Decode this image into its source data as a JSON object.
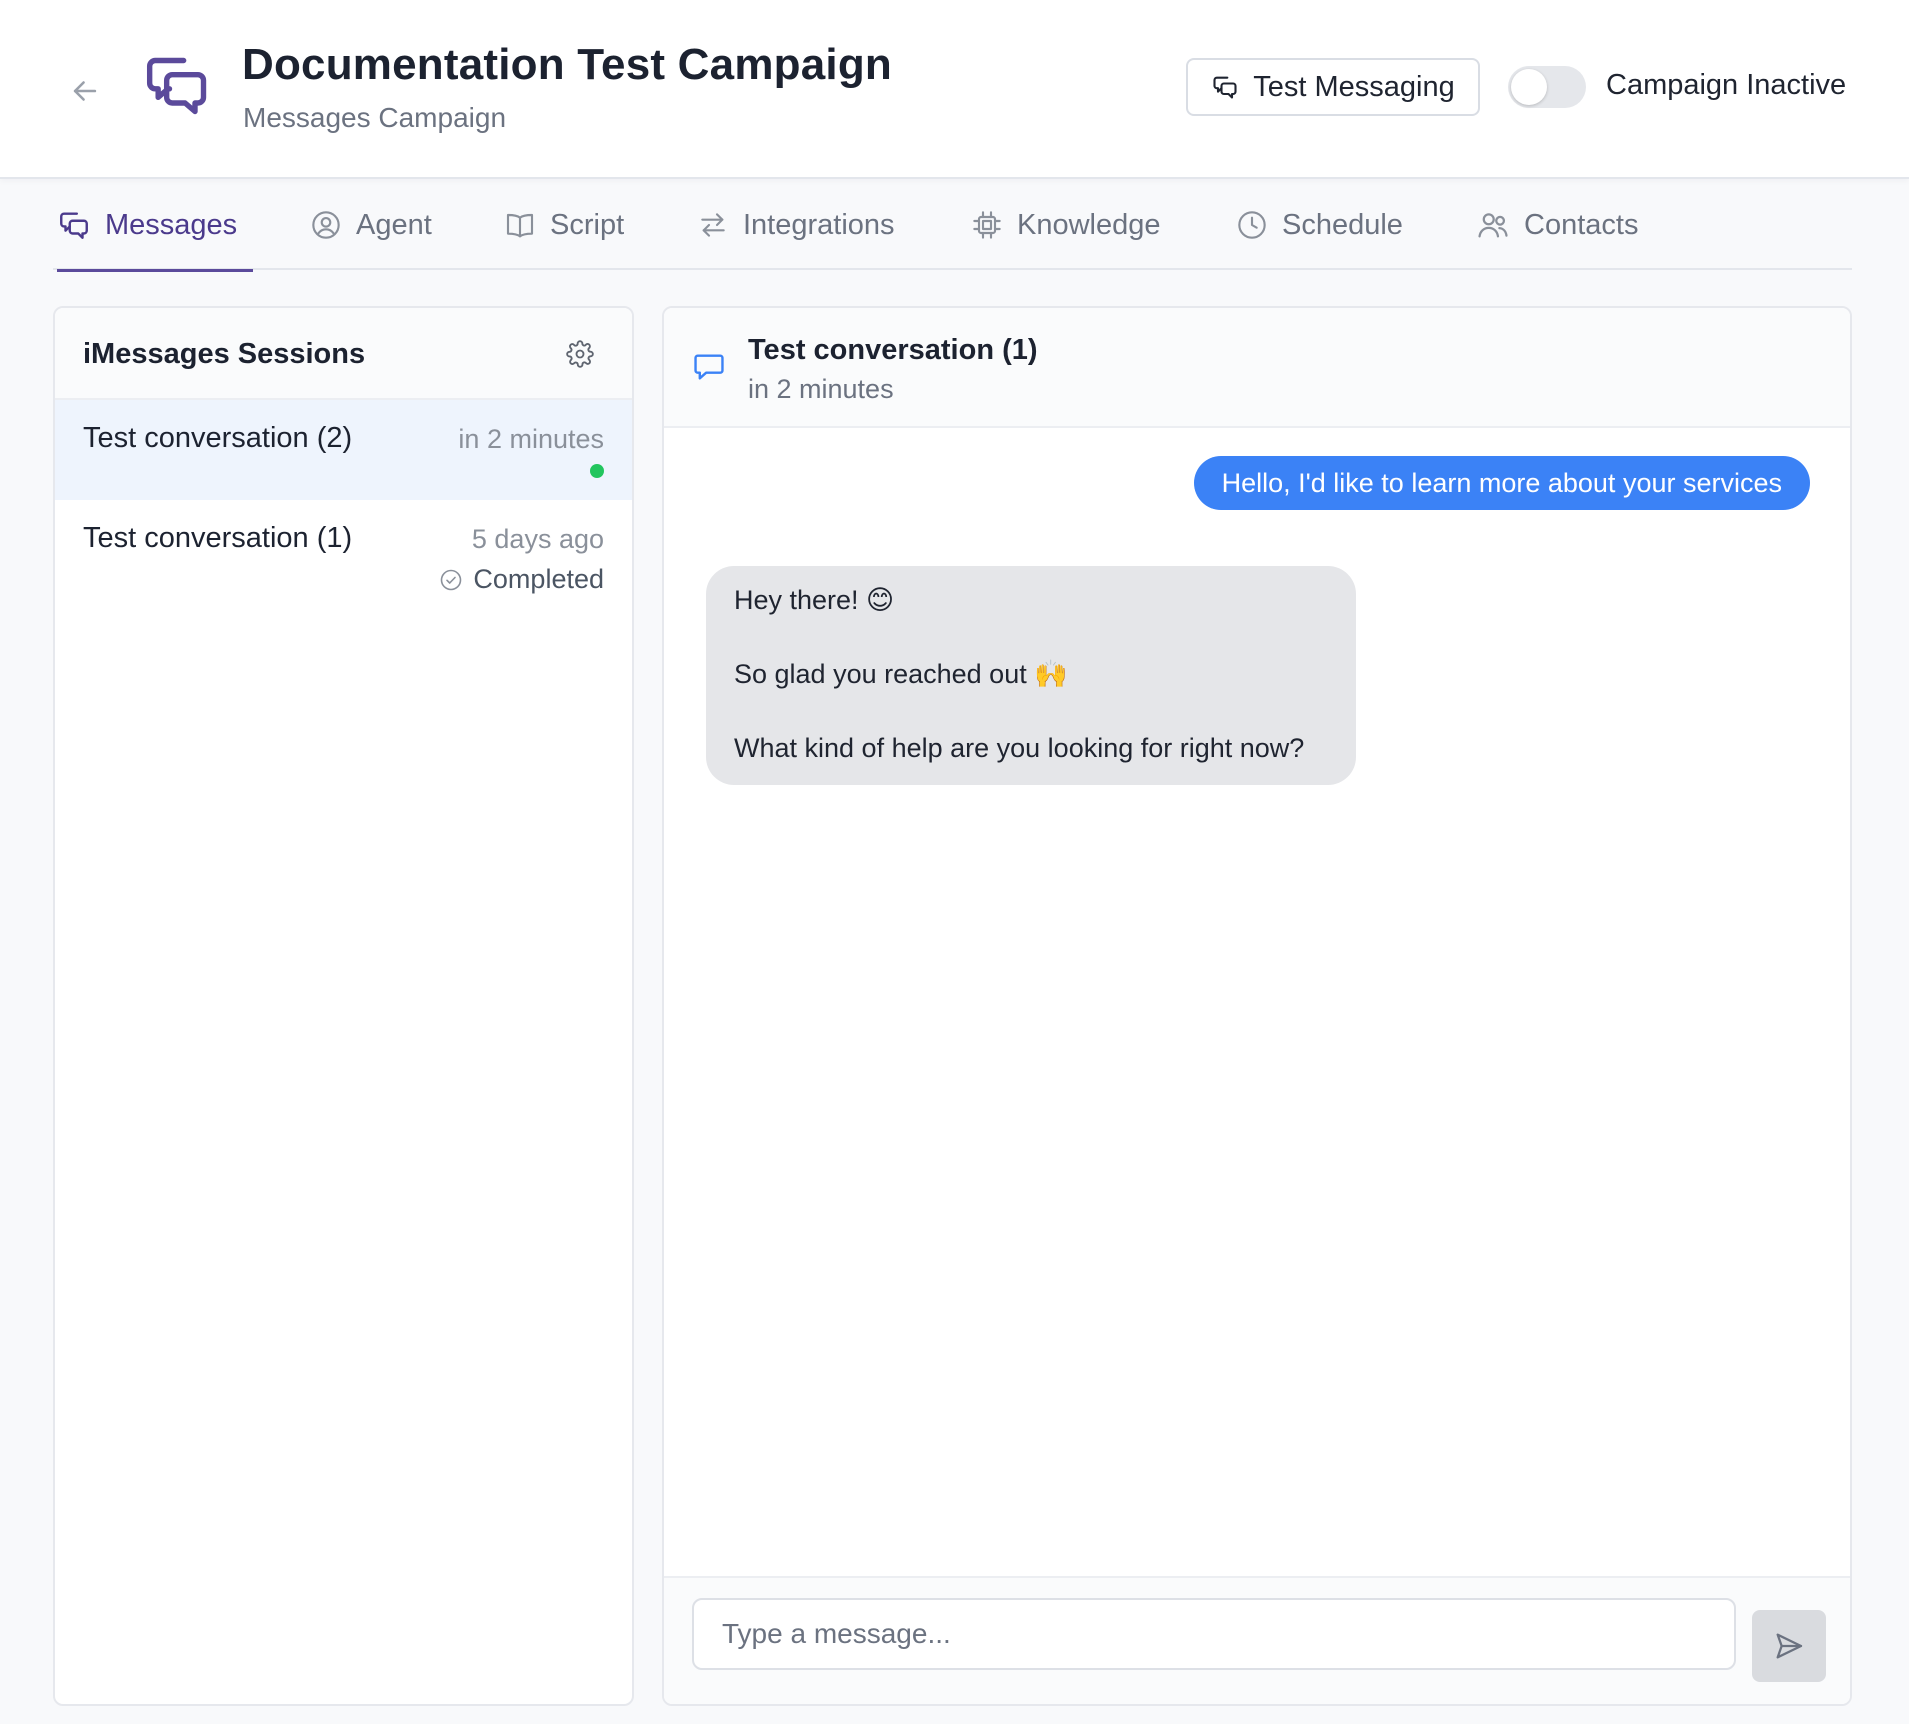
{
  "header": {
    "title": "Documentation Test Campaign",
    "subtitle": "Messages Campaign",
    "test_button_label": "Test Messaging",
    "status_label": "Campaign Inactive",
    "campaign_active": false,
    "brand_color": "#5b4a9b"
  },
  "tabs": [
    {
      "label": "Messages",
      "icon": "chat-bubbles-icon",
      "active": true
    },
    {
      "label": "Agent",
      "icon": "user-circle-icon",
      "active": false
    },
    {
      "label": "Script",
      "icon": "book-icon",
      "active": false
    },
    {
      "label": "Integrations",
      "icon": "arrows-exchange-icon",
      "active": false
    },
    {
      "label": "Knowledge",
      "icon": "chip-icon",
      "active": false
    },
    {
      "label": "Schedule",
      "icon": "clock-icon",
      "active": false
    },
    {
      "label": "Contacts",
      "icon": "users-icon",
      "active": false
    }
  ],
  "sessions": {
    "title": "iMessages Sessions",
    "items": [
      {
        "name": "Test conversation (2)",
        "time": "in 2 minutes",
        "online": true,
        "selected": true
      },
      {
        "name": "Test conversation (1)",
        "time": "5 days ago",
        "status": "Completed",
        "selected": false
      }
    ]
  },
  "chat": {
    "title": "Test conversation (1)",
    "subtitle": "in 2 minutes",
    "messages": [
      {
        "from": "user",
        "text": "Hello, I'd like to learn more about your services"
      },
      {
        "from": "agent",
        "lines": [
          "Hey there! 😊",
          "So glad you reached out 🙌",
          "What kind of help are you looking for right now?"
        ]
      }
    ],
    "input_placeholder": "Type a message...",
    "user_bubble_color": "#3b82f6",
    "agent_bubble_color": "#e5e6e9"
  }
}
